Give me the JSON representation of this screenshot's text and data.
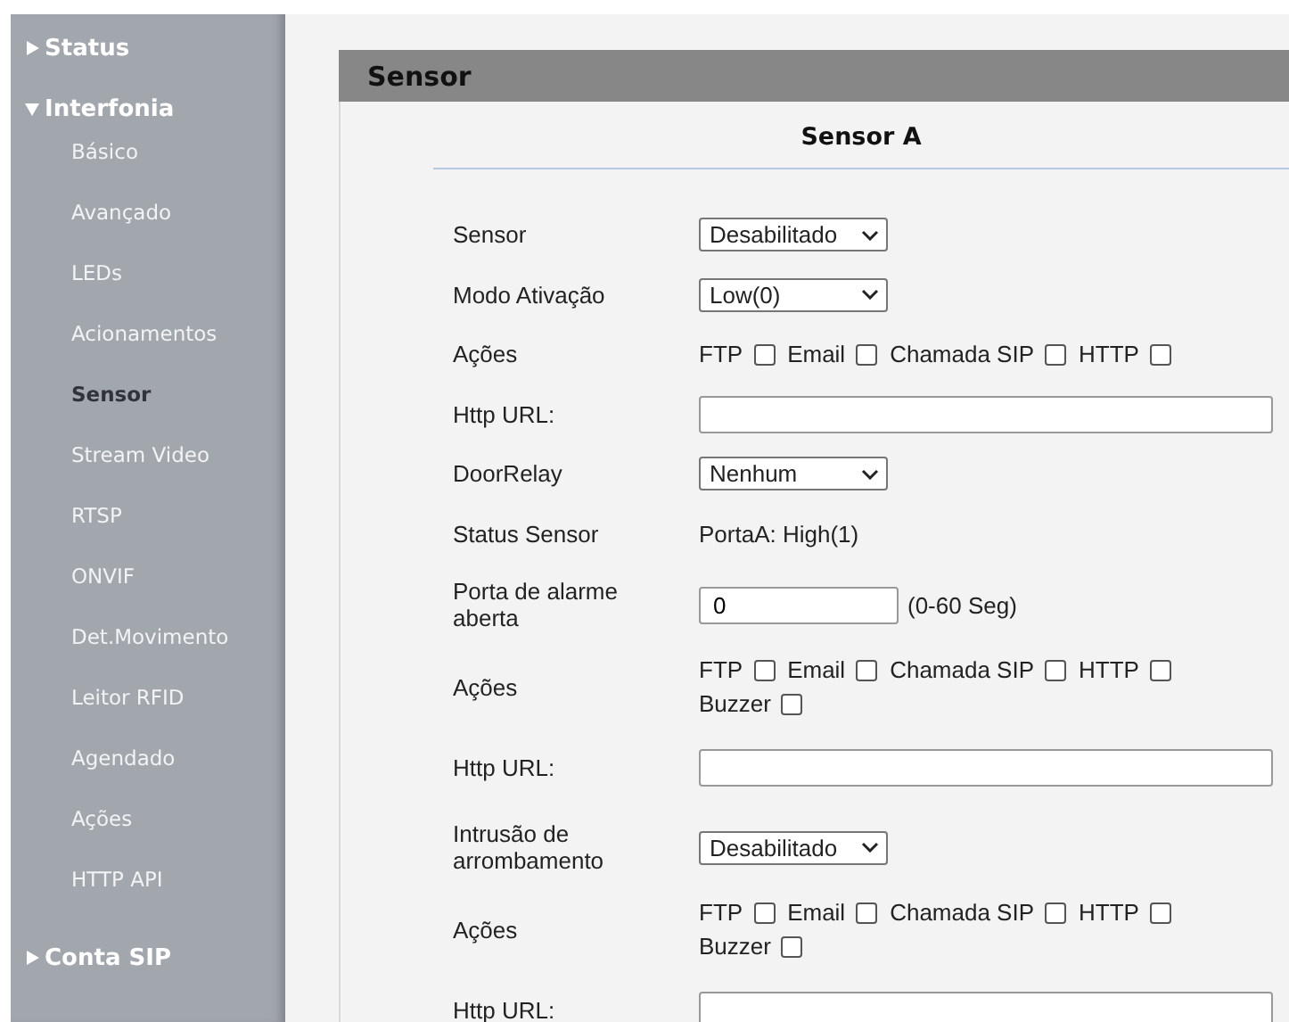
{
  "sidebar": {
    "groups": [
      {
        "label": "Status",
        "expanded": false
      },
      {
        "label": "Interfonia",
        "expanded": true,
        "children": [
          {
            "label": "Básico",
            "selected": false
          },
          {
            "label": "Avançado",
            "selected": false
          },
          {
            "label": "LEDs",
            "selected": false
          },
          {
            "label": "Acionamentos",
            "selected": false
          },
          {
            "label": "Sensor",
            "selected": true
          },
          {
            "label": "Stream Video",
            "selected": false
          },
          {
            "label": "RTSP",
            "selected": false
          },
          {
            "label": "ONVIF",
            "selected": false
          },
          {
            "label": "Det.Movimento",
            "selected": false
          },
          {
            "label": "Leitor RFID",
            "selected": false
          },
          {
            "label": "Agendado",
            "selected": false
          },
          {
            "label": "Ações",
            "selected": false
          },
          {
            "label": "HTTP API",
            "selected": false
          }
        ]
      },
      {
        "label": "Conta SIP",
        "expanded": false
      }
    ]
  },
  "panel": {
    "title": "Sensor",
    "section_title": "Sensor A",
    "rows": [
      {
        "kind": "select",
        "label": "Sensor",
        "value": "Desabilitado"
      },
      {
        "kind": "select",
        "label": "Modo Ativação",
        "value": "Low(0)"
      },
      {
        "kind": "checks",
        "label": "Ações",
        "options": [
          {
            "label": "FTP",
            "checked": false
          },
          {
            "label": "Email",
            "checked": false
          },
          {
            "label": "Chamada SIP",
            "checked": false
          },
          {
            "label": "HTTP",
            "checked": false
          }
        ]
      },
      {
        "kind": "text",
        "label": "Http URL:"
      },
      {
        "kind": "select",
        "label": "DoorRelay",
        "value": "Nenhum"
      },
      {
        "kind": "static",
        "label": "Status Sensor",
        "value": "PortaA: High(1)"
      },
      {
        "kind": "number",
        "label": "Porta de alarme aberta",
        "value": "0",
        "unit": "(0-60 Seg)"
      },
      {
        "kind": "checks",
        "label": "Ações",
        "options": [
          {
            "label": "FTP",
            "checked": false
          },
          {
            "label": "Email",
            "checked": false
          },
          {
            "label": "Chamada SIP",
            "checked": false
          },
          {
            "label": "HTTP",
            "checked": false
          },
          {
            "label": "Buzzer",
            "checked": false
          }
        ]
      },
      {
        "kind": "text",
        "label": "Http URL:"
      },
      {
        "kind": "select",
        "label": "Intrusão de arrombamento",
        "value": "Desabilitado"
      },
      {
        "kind": "checks",
        "label": "Ações",
        "options": [
          {
            "label": "FTP",
            "checked": false
          },
          {
            "label": "Email",
            "checked": false
          },
          {
            "label": "Chamada SIP",
            "checked": false
          },
          {
            "label": "HTTP",
            "checked": false
          },
          {
            "label": "Buzzer",
            "checked": false
          }
        ]
      },
      {
        "kind": "text",
        "label": "Http URL:"
      }
    ]
  }
}
